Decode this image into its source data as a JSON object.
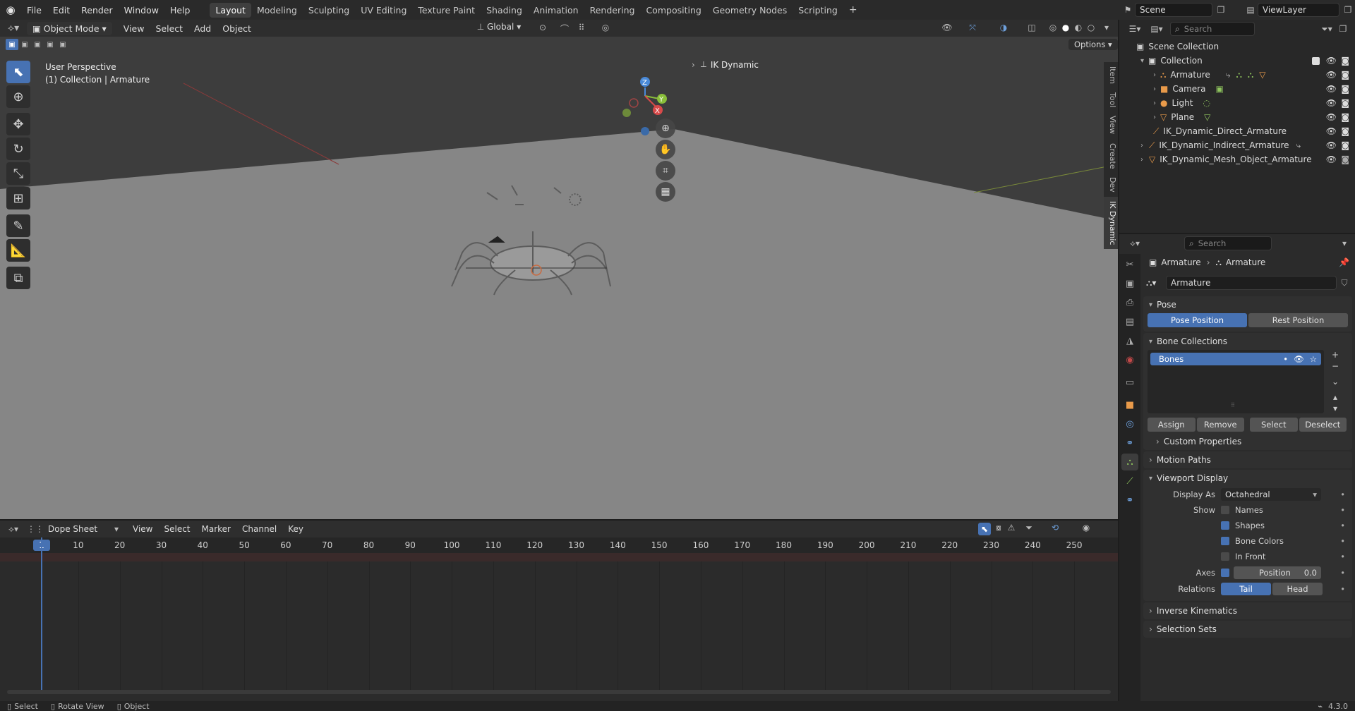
{
  "menus": [
    "File",
    "Edit",
    "Render",
    "Window",
    "Help"
  ],
  "workspaces": [
    "Layout",
    "Modeling",
    "Sculpting",
    "UV Editing",
    "Texture Paint",
    "Shading",
    "Animation",
    "Rendering",
    "Compositing",
    "Geometry Nodes",
    "Scripting"
  ],
  "scene": {
    "name": "Scene",
    "view_layer": "ViewLayer"
  },
  "viewport": {
    "mode": "Object Mode",
    "menus": [
      "View",
      "Select",
      "Add",
      "Object"
    ],
    "orientation": "Global",
    "options": "Options",
    "info_line1": "User Perspective",
    "info_line2": "(1) Collection | Armature",
    "ik_panel": "IK Dynamic",
    "sidebar_tabs": [
      "Item",
      "Tool",
      "View",
      "Create",
      "Dev",
      "IK Dynamic"
    ],
    "axes": [
      "Z",
      "Y",
      "X"
    ]
  },
  "dope": {
    "type": "Dope Sheet",
    "menus": [
      "View",
      "Select",
      "Marker",
      "Channel",
      "Key"
    ],
    "current_frame": "1",
    "frames": [
      "10",
      "20",
      "30",
      "40",
      "50",
      "60",
      "70",
      "80",
      "90",
      "100",
      "110",
      "120",
      "130",
      "140",
      "150",
      "160",
      "170",
      "180",
      "190",
      "200",
      "210",
      "220",
      "230",
      "240",
      "250"
    ]
  },
  "outliner": {
    "search_placeholder": "Search",
    "root": "Scene Collection",
    "collection": "Collection",
    "children": [
      "Armature",
      "Camera",
      "Light",
      "Plane"
    ],
    "others": [
      "IK_Dynamic_Direct_Armature",
      "IK_Dynamic_Indirect_Armature",
      "IK_Dynamic_Mesh_Object_Armature"
    ]
  },
  "props": {
    "search_placeholder": "Search",
    "crumb_object": "Armature",
    "crumb_data": "Armature",
    "data_name": "Armature",
    "pose_header": "Pose",
    "pose_position": "Pose Position",
    "rest_position": "Rest Position",
    "bone_collections": "Bone Collections",
    "bones": "Bones",
    "assign": "Assign",
    "remove": "Remove",
    "select": "Select",
    "deselect": "Deselect",
    "custom_props": "Custom Properties",
    "motion_paths": "Motion Paths",
    "viewport_display": "Viewport Display",
    "display_as_label": "Display As",
    "display_as": "Octahedral",
    "show_label": "Show",
    "names": "Names",
    "shapes": "Shapes",
    "bone_colors": "Bone Colors",
    "in_front": "In Front",
    "axes_label": "Axes",
    "position": "Position",
    "position_val": "0.0",
    "relations_label": "Relations",
    "tail": "Tail",
    "head": "Head",
    "ik": "Inverse Kinematics",
    "selection_sets": "Selection Sets"
  },
  "status": {
    "select": "Select",
    "rotate": "Rotate View",
    "object": "Object",
    "version": "4.3.0"
  }
}
